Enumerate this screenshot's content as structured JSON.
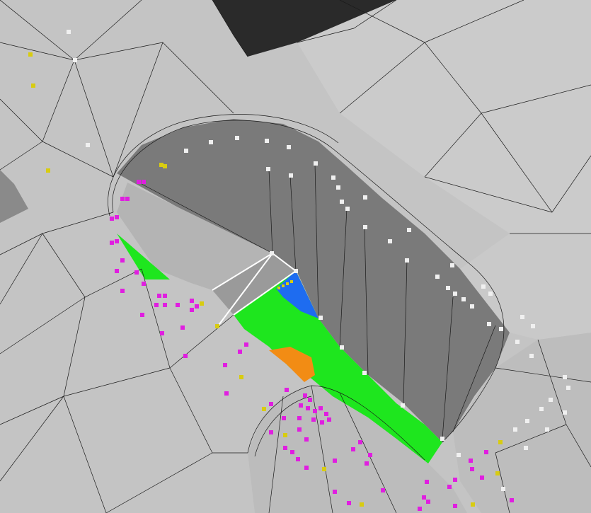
{
  "viewport": {
    "background": "#6f7480",
    "surface_color": "#c4c4c4",
    "pocket_floor_color": "#b4b4b4",
    "pocket_wall_color": "#7a7a7a",
    "shadow_color": "#303030"
  },
  "selection": {
    "green_color": "#1ee61e",
    "blue_color": "#1e6cf0",
    "orange_color": "#f28c14",
    "outline_color": "#ffffff"
  },
  "markers": {
    "white_color": "#f0f0f0",
    "magenta_color": "#e01ee0",
    "yellow_color": "#d8cc10"
  }
}
